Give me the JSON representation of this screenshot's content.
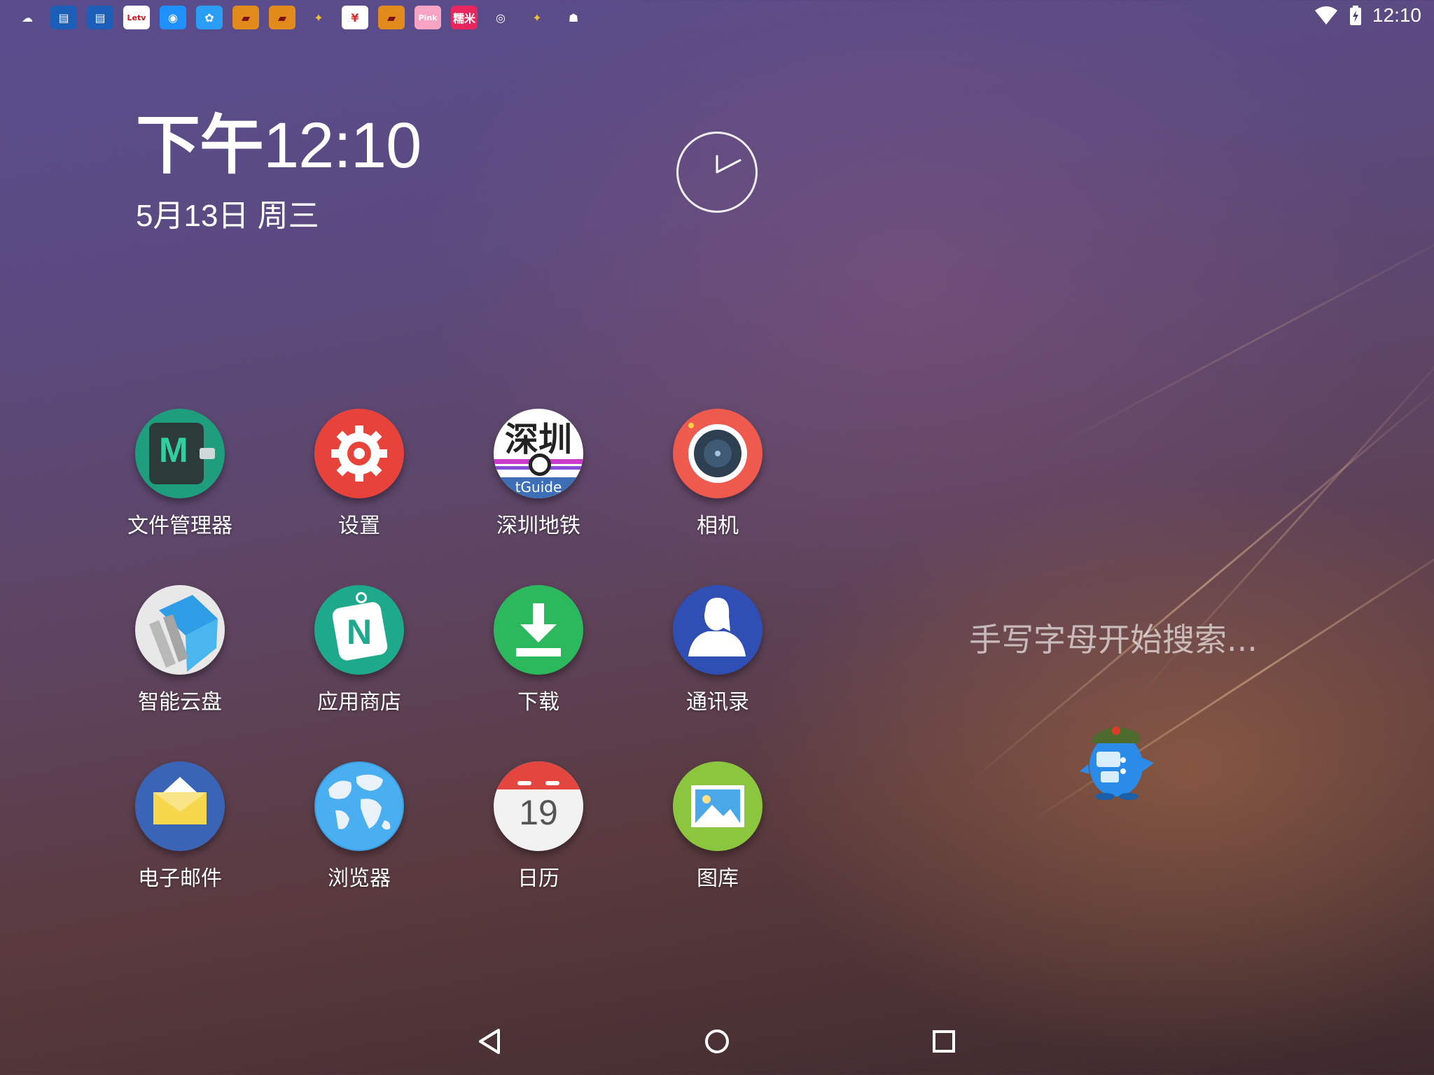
{
  "status_bar": {
    "notification_icons": [
      {
        "name": "weather-cloud-icon",
        "glyph": "☁",
        "bg": "transparent",
        "fg": "#ffffff"
      },
      {
        "name": "calendar-widget-icon",
        "glyph": "▤",
        "bg": "#1b5fb8",
        "fg": "#ffffff"
      },
      {
        "name": "calendar-widget-icon-2",
        "glyph": "▤",
        "bg": "#1b5fb8",
        "fg": "#ffffff"
      },
      {
        "name": "letv-app-icon",
        "glyph": "Letv",
        "bg": "#ffffff",
        "fg": "#d1141b"
      },
      {
        "name": "maps-pin-icon",
        "glyph": "◉",
        "bg": "#1e90ff",
        "fg": "#ffffff"
      },
      {
        "name": "app-store-icon",
        "glyph": "✿",
        "bg": "#2a9df4",
        "fg": "#ffffff"
      },
      {
        "name": "game-app-icon",
        "glyph": "▰",
        "bg": "#e08b1b",
        "fg": "#7a1010"
      },
      {
        "name": "game-app-icon-2",
        "glyph": "▰",
        "bg": "#e08b1b",
        "fg": "#7a1010"
      },
      {
        "name": "bird-logo-icon",
        "glyph": "✦",
        "bg": "transparent",
        "fg": "#f2c231"
      },
      {
        "name": "yuan-app-icon",
        "glyph": "¥",
        "bg": "#ffffff",
        "fg": "#d62b2b"
      },
      {
        "name": "game-app-icon-3",
        "glyph": "▰",
        "bg": "#e08b1b",
        "fg": "#7a1010"
      },
      {
        "name": "pink-app-icon",
        "glyph": "Pink",
        "bg": "#f6a3c4",
        "fg": "#ffffff"
      },
      {
        "name": "red-app-icon",
        "glyph": "糯米",
        "bg": "#e8265d",
        "fg": "#ffffff"
      },
      {
        "name": "location-search-icon",
        "glyph": "◎",
        "bg": "transparent",
        "fg": "#ffffff"
      },
      {
        "name": "bird-logo-icon-2",
        "glyph": "✦",
        "bg": "transparent",
        "fg": "#f2c231"
      },
      {
        "name": "android-icon",
        "glyph": "☗",
        "bg": "transparent",
        "fg": "#ffffff"
      }
    ],
    "time": "12:10"
  },
  "clock_widget": {
    "ampm": "下午",
    "time": "12:10",
    "date": "5月13日 周三"
  },
  "apps": [
    {
      "label": "文件管理器",
      "icon": "file-manager-icon"
    },
    {
      "label": "设置",
      "icon": "settings-gear-icon"
    },
    {
      "label": "深圳地铁",
      "icon": "shenzhen-metro-icon",
      "icon_text": "深圳",
      "icon_subtext": "tGuide"
    },
    {
      "label": "相机",
      "icon": "camera-icon"
    },
    {
      "label": "智能云盘",
      "icon": "cloud-drive-icon"
    },
    {
      "label": "应用商店",
      "icon": "app-store-icon",
      "icon_text": "N"
    },
    {
      "label": "下载",
      "icon": "download-icon"
    },
    {
      "label": "通讯录",
      "icon": "contacts-icon"
    },
    {
      "label": "电子邮件",
      "icon": "email-icon"
    },
    {
      "label": "浏览器",
      "icon": "browser-globe-icon"
    },
    {
      "label": "日历",
      "icon": "calendar-icon",
      "icon_text": "19"
    },
    {
      "label": "图库",
      "icon": "gallery-icon"
    }
  ],
  "search_hint": "手写字母开始搜索...",
  "colors": {
    "settings": "#e8433a",
    "camera": "#ee5a4e",
    "download": "#2cb85c",
    "contacts": "#2f4fb5",
    "email": "#3a64b5",
    "gallery": "#8cc63e",
    "file_manager": "#1f9e7e"
  }
}
